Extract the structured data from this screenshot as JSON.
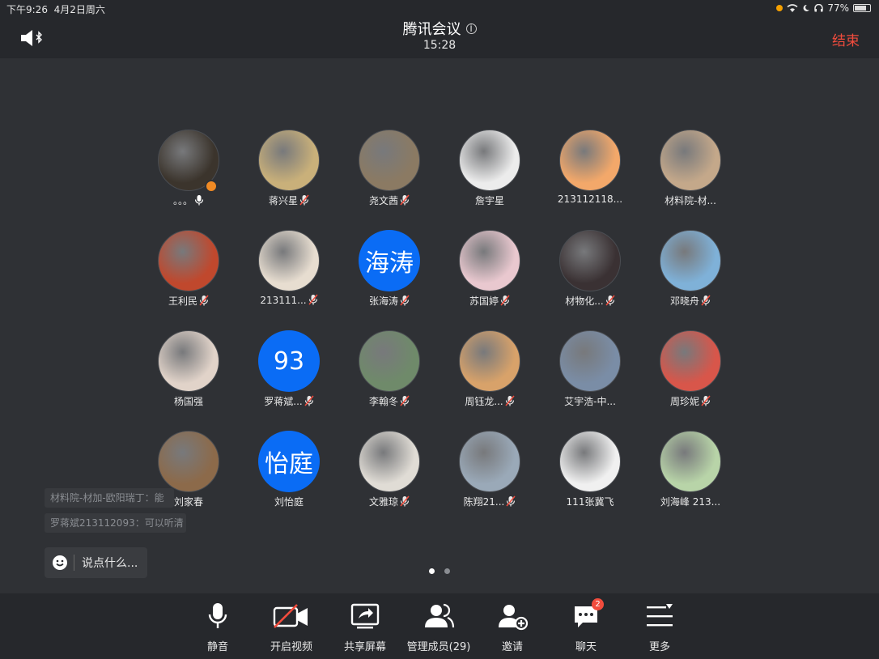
{
  "status_bar": {
    "time": "下午9:26",
    "date": "4月2日周六",
    "battery": "77%"
  },
  "header": {
    "title": "腾讯会议",
    "timer": "15:28",
    "end_label": "结束"
  },
  "members": [
    {
      "name": "。。。",
      "avatar_color": "#3b342c",
      "mic": "on",
      "host": true
    },
    {
      "name": "蒋兴星",
      "avatar_color": "#c9b07a",
      "mic": "muted"
    },
    {
      "name": "尧文茜",
      "avatar_color": "#8b7a63",
      "mic": "muted"
    },
    {
      "name": "詹宇星",
      "avatar_color": "#ececec",
      "mic": "none"
    },
    {
      "name": "213112118...",
      "avatar_color": "#f3a86a",
      "mic": "none"
    },
    {
      "name": "材料院-材...",
      "avatar_color": "#c4a88a",
      "mic": "none"
    },
    {
      "name": "王利民",
      "avatar_color": "#c0482d",
      "mic": "muted"
    },
    {
      "name": "213111...",
      "avatar_color": "#e7ddd0",
      "mic": "muted"
    },
    {
      "name": "张海涛",
      "avatar_text": "海涛",
      "mic": "muted"
    },
    {
      "name": "苏国婷",
      "avatar_color": "#e9c8cf",
      "mic": "muted"
    },
    {
      "name": "材物化...",
      "avatar_color": "#3a3133",
      "mic": "muted"
    },
    {
      "name": "邓晓舟",
      "avatar_color": "#7fb1d8",
      "mic": "muted"
    },
    {
      "name": "杨国强",
      "avatar_color": "#e1d3c9",
      "mic": "none"
    },
    {
      "name": "罗蒋斌...",
      "avatar_text": "93",
      "mic": "muted"
    },
    {
      "name": "李翰冬",
      "avatar_color": "#6f8a6a",
      "mic": "muted"
    },
    {
      "name": "周钰龙...",
      "avatar_color": "#d8a26a",
      "mic": "muted"
    },
    {
      "name": "艾宇浩-中...",
      "avatar_color": "#7a8da6",
      "mic": "none"
    },
    {
      "name": "周珍妮",
      "avatar_color": "#d8564a",
      "mic": "muted"
    },
    {
      "name": "刘家春",
      "avatar_color": "#8c6a4a",
      "mic": "none"
    },
    {
      "name": "刘怡庭",
      "avatar_text": "怡庭",
      "mic": "none"
    },
    {
      "name": "文雅琼",
      "avatar_color": "#e0dcd5",
      "mic": "muted"
    },
    {
      "name": "陈翔21...",
      "avatar_color": "#9aa9b8",
      "mic": "muted"
    },
    {
      "name": "111张冀飞",
      "avatar_color": "#f0f0f0",
      "mic": "none"
    },
    {
      "name": "刘海峰 213...",
      "avatar_color": "#b8d4a8",
      "mic": "none"
    }
  ],
  "chat": {
    "messages": [
      {
        "text": "材料院-材加-欧阳瑞丁：能"
      },
      {
        "text": "罗蒋斌213112093：可以听清"
      }
    ],
    "input_placeholder": "说点什么..."
  },
  "pagination": {
    "count": 2,
    "active": 1
  },
  "toolbar": [
    {
      "label": "静音",
      "icon": "mic-icon"
    },
    {
      "label": "开启视频",
      "icon": "camera-off-icon"
    },
    {
      "label": "共享屏幕",
      "icon": "share-screen-icon"
    },
    {
      "label": "管理成员(29)",
      "icon": "members-icon"
    },
    {
      "label": "邀请",
      "icon": "invite-icon"
    },
    {
      "label": "聊天",
      "icon": "chat-icon",
      "badge": "2"
    },
    {
      "label": "更多",
      "icon": "more-icon"
    }
  ],
  "colors": {
    "accent": "#0a6cf5",
    "danger": "#f24c3d",
    "background": "#2f3135",
    "bar": "#26282c"
  }
}
